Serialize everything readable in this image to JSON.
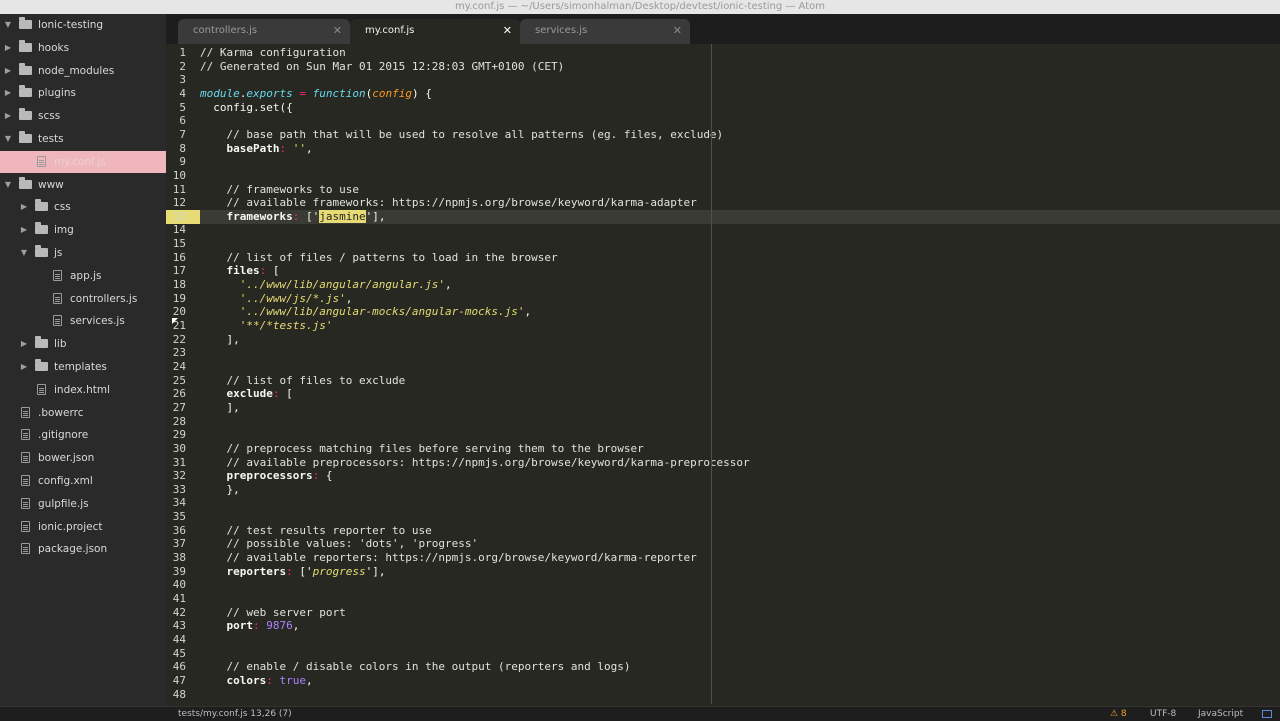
{
  "window": {
    "title": "my.conf.js — ~/Users/simonhalman/Desktop/devtest/ionic-testing — Atom"
  },
  "sidebar": {
    "rows": [
      {
        "label": "Ionic-testing",
        "type": "folder",
        "depth": 0,
        "expanded": true
      },
      {
        "label": "hooks",
        "type": "folder",
        "depth": 0,
        "expanded": false
      },
      {
        "label": "node_modules",
        "type": "folder",
        "depth": 0,
        "expanded": false
      },
      {
        "label": "plugins",
        "type": "folder",
        "depth": 0,
        "expanded": false
      },
      {
        "label": "scss",
        "type": "folder",
        "depth": 0,
        "expanded": false
      },
      {
        "label": "tests",
        "type": "folder",
        "depth": 0,
        "expanded": true
      },
      {
        "label": "my.conf.js",
        "type": "file",
        "depth": 1,
        "selected": true
      },
      {
        "label": "www",
        "type": "folder",
        "depth": 0,
        "expanded": true
      },
      {
        "label": "css",
        "type": "folder",
        "depth": 1,
        "expanded": false
      },
      {
        "label": "img",
        "type": "folder",
        "depth": 1,
        "expanded": false
      },
      {
        "label": "js",
        "type": "folder",
        "depth": 1,
        "expanded": true
      },
      {
        "label": "app.js",
        "type": "file",
        "depth": 2
      },
      {
        "label": "controllers.js",
        "type": "file",
        "depth": 2
      },
      {
        "label": "services.js",
        "type": "file",
        "depth": 2
      },
      {
        "label": "lib",
        "type": "folder",
        "depth": 1,
        "expanded": false
      },
      {
        "label": "templates",
        "type": "folder",
        "depth": 1,
        "expanded": false
      },
      {
        "label": "index.html",
        "type": "file",
        "depth": 1
      },
      {
        "label": ".bowerrc",
        "type": "file",
        "depth": 0
      },
      {
        "label": ".gitignore",
        "type": "file",
        "depth": 0
      },
      {
        "label": "bower.json",
        "type": "file",
        "depth": 0
      },
      {
        "label": "config.xml",
        "type": "file",
        "depth": 0
      },
      {
        "label": "gulpfile.js",
        "type": "file",
        "depth": 0
      },
      {
        "label": "ionic.project",
        "type": "file",
        "depth": 0
      },
      {
        "label": "package.json",
        "type": "file",
        "depth": 0
      }
    ]
  },
  "tabs": [
    {
      "label": "controllers.js",
      "active": false
    },
    {
      "label": "my.conf.js",
      "active": true
    },
    {
      "label": "services.js",
      "active": false
    }
  ],
  "editor": {
    "current_line": 13,
    "lines": [
      [
        {
          "t": "// Karma configuration",
          "c": "comment"
        }
      ],
      [
        {
          "t": "// Generated on Sun Mar 01 2015 12:28:03 GMT+0100 (CET)",
          "c": "comment"
        }
      ],
      [],
      [
        {
          "t": "module",
          "c": "obj"
        },
        {
          "t": ".",
          "c": "plain"
        },
        {
          "t": "exports",
          "c": "obj"
        },
        {
          "t": " = ",
          "c": "op"
        },
        {
          "t": "function",
          "c": "fn"
        },
        {
          "t": "(",
          "c": "plain"
        },
        {
          "t": "config",
          "c": "param"
        },
        {
          "t": ") {",
          "c": "plain"
        }
      ],
      [
        {
          "t": "  config.set({",
          "c": "plain"
        }
      ],
      [],
      [
        {
          "t": "    // base path that will be used to resolve all patterns (eg. files, exclude)",
          "c": "comment"
        }
      ],
      [
        {
          "t": "    basePath",
          "c": "key"
        },
        {
          "t": ": ",
          "c": "op"
        },
        {
          "t": "''",
          "c": "str"
        },
        {
          "t": ",",
          "c": "plain"
        }
      ],
      [],
      [],
      [
        {
          "t": "    // frameworks to use",
          "c": "comment"
        }
      ],
      [
        {
          "t": "    // available frameworks: https://npmjs.org/browse/keyword/karma-adapter",
          "c": "comment"
        }
      ],
      [
        {
          "t": "    frameworks",
          "c": "key"
        },
        {
          "t": ": ",
          "c": "op"
        },
        {
          "t": "['",
          "c": "plain"
        },
        {
          "t": "jasmine",
          "c": "hl"
        },
        {
          "t": "'],",
          "c": "plain"
        }
      ],
      [],
      [],
      [
        {
          "t": "    // list of files / patterns to load in the browser",
          "c": "comment"
        }
      ],
      [
        {
          "t": "    files",
          "c": "key"
        },
        {
          "t": ": ",
          "c": "op"
        },
        {
          "t": "[",
          "c": "plain"
        }
      ],
      [
        {
          "t": "      '../www/lib/angular/angular.js'",
          "c": "str"
        },
        {
          "t": ",",
          "c": "plain"
        }
      ],
      [
        {
          "t": "      '../www/js/*.js'",
          "c": "str"
        },
        {
          "t": ",",
          "c": "plain"
        }
      ],
      [
        {
          "t": "      '../www/lib/angular-mocks/angular-mocks.js'",
          "c": "str"
        },
        {
          "t": ",",
          "c": "plain"
        }
      ],
      [
        {
          "t": "      '**/*tests.js'",
          "c": "str"
        }
      ],
      [
        {
          "t": "    ],",
          "c": "plain"
        }
      ],
      [],
      [],
      [
        {
          "t": "    // list of files to exclude",
          "c": "comment"
        }
      ],
      [
        {
          "t": "    exclude",
          "c": "key"
        },
        {
          "t": ": ",
          "c": "op"
        },
        {
          "t": "[",
          "c": "plain"
        }
      ],
      [
        {
          "t": "    ],",
          "c": "plain"
        }
      ],
      [],
      [],
      [
        {
          "t": "    // preprocess matching files before serving them to the browser",
          "c": "comment"
        }
      ],
      [
        {
          "t": "    // available preprocessors: https://npmjs.org/browse/keyword/karma-preprocessor",
          "c": "comment"
        }
      ],
      [
        {
          "t": "    preprocessors",
          "c": "key"
        },
        {
          "t": ": ",
          "c": "op"
        },
        {
          "t": "{",
          "c": "plain"
        }
      ],
      [
        {
          "t": "    },",
          "c": "plain"
        }
      ],
      [],
      [],
      [
        {
          "t": "    // test results reporter to use",
          "c": "comment"
        }
      ],
      [
        {
          "t": "    // possible values: 'dots', 'progress'",
          "c": "comment"
        }
      ],
      [
        {
          "t": "    // available reporters: https://npmjs.org/browse/keyword/karma-reporter",
          "c": "comment"
        }
      ],
      [
        {
          "t": "    reporters",
          "c": "key"
        },
        {
          "t": ": ",
          "c": "op"
        },
        {
          "t": "['",
          "c": "plain"
        },
        {
          "t": "progress",
          "c": "str"
        },
        {
          "t": "'],",
          "c": "plain"
        }
      ],
      [],
      [],
      [
        {
          "t": "    // web server port",
          "c": "comment"
        }
      ],
      [
        {
          "t": "    port",
          "c": "key"
        },
        {
          "t": ": ",
          "c": "op"
        },
        {
          "t": "9876",
          "c": "num"
        },
        {
          "t": ",",
          "c": "plain"
        }
      ],
      [],
      [],
      [
        {
          "t": "    // enable / disable colors in the output (reporters and logs)",
          "c": "comment"
        }
      ],
      [
        {
          "t": "    colors",
          "c": "key"
        },
        {
          "t": ": ",
          "c": "op"
        },
        {
          "t": "true",
          "c": "num"
        },
        {
          "t": ",",
          "c": "plain"
        }
      ],
      []
    ]
  },
  "status": {
    "file": "tests/my.conf.js",
    "position": "13,26",
    "selection": "(7)",
    "warnings": "⚠ 8",
    "encoding": "UTF-8",
    "grammar": "JavaScript"
  },
  "colors": {
    "background": "#272822",
    "sidebar": "#2a2a2a",
    "selection": "#f0b6bd",
    "highlight": "#e6db74"
  }
}
